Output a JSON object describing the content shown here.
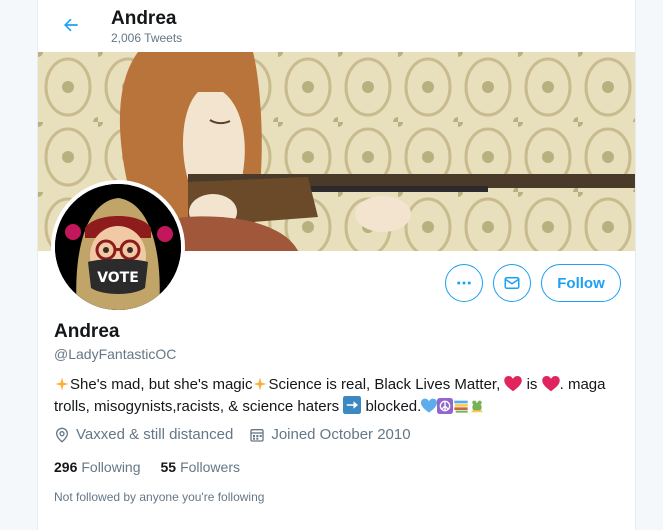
{
  "header": {
    "back_icon": "arrow-left-icon",
    "title": "Andrea",
    "tweet_count": "2,006 Tweets"
  },
  "banner": {
    "description": ""
  },
  "avatar": {
    "badge_text": "VOTE"
  },
  "actions": {
    "more_icon": "more-dots-icon",
    "message_icon": "envelope-icon",
    "follow_label": "Follow"
  },
  "profile": {
    "name": "Andrea",
    "handle": "@LadyFantasticOC",
    "bio_part1": "She's mad, but she's magic",
    "bio_part2": "Science is real, Black Lives Matter,",
    "bio_part3": "is",
    "bio_part4": ". maga trolls, misogynists,racists, & science haters",
    "bio_part5": "blocked.",
    "location": "Vaxxed & still distanced",
    "joined": "Joined October 2010",
    "following_count": "296",
    "following_label": "Following",
    "followers_count": "55",
    "followers_label": "Followers",
    "followed_by_note": "Not followed by anyone you're following"
  },
  "colors": {
    "accent": "#1da1f2",
    "secondary_text": "#657786",
    "heart": "#e0245e"
  }
}
